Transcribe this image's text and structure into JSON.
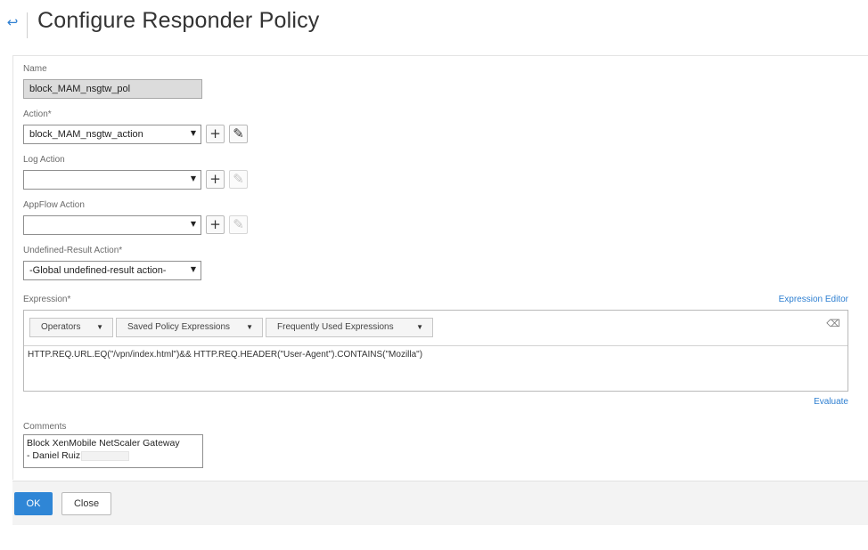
{
  "header": {
    "back_icon": "back-arrow-icon",
    "title": "Configure Responder Policy"
  },
  "form": {
    "name": {
      "label": "Name",
      "value": "block_MAM_nsgtw_pol"
    },
    "action": {
      "label": "Action*",
      "value": "block_MAM_nsgtw_action"
    },
    "log_action": {
      "label": "Log Action",
      "value": ""
    },
    "appflow_action": {
      "label": "AppFlow Action",
      "value": ""
    },
    "undefined_result_action": {
      "label": "Undefined-Result Action*",
      "value": "-Global undefined-result action-"
    },
    "expression": {
      "label": "Expression*",
      "editor_link": "Expression Editor",
      "toolbar": [
        "Operators",
        "Saved Policy Expressions",
        "Frequently Used Expressions"
      ],
      "value": "HTTP.REQ.URL.EQ(\"/vpn/index.html\")&& HTTP.REQ.HEADER(\"User-Agent\").CONTAINS(\"Mozilla\")",
      "evaluate_link": "Evaluate"
    },
    "comments": {
      "label": "Comments",
      "line1": "Block XenMobile NetScaler Gateway",
      "line2": "- Daniel Ruiz"
    }
  },
  "icons": {
    "add": "+",
    "edit": "✎",
    "caret": "▼",
    "clear": "⌫"
  },
  "footer": {
    "ok_label": "OK",
    "close_label": "Close"
  },
  "colors": {
    "accent": "#2f86d6",
    "link": "#2e7fd1"
  }
}
